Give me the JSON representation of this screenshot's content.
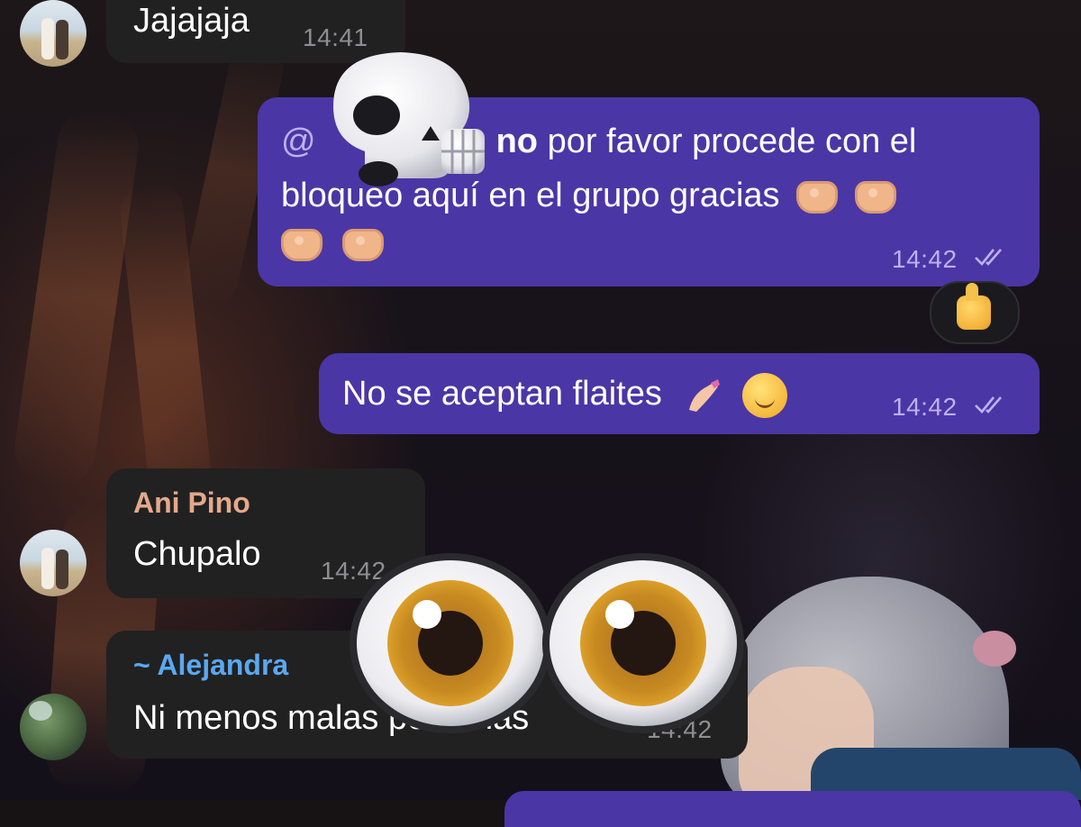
{
  "messages": [
    {
      "id": "m1",
      "direction": "incoming",
      "text": "Jajajaja",
      "time": "14:41"
    },
    {
      "id": "m2",
      "direction": "outgoing",
      "mention_prefix": "@",
      "mention_tail": "no",
      "text_line1": "por favor procede con el",
      "text_line2": "bloqueo aquí en el grupo gracias",
      "emoji": "heart-hands-emoji",
      "time": "14:42",
      "status": "read-double-check",
      "reaction": "thumbs-up-emoji"
    },
    {
      "id": "m3",
      "direction": "outgoing",
      "text": "No se aceptan flaites",
      "emojis": [
        "nail-polish-emoji",
        "relieved-face-emoji"
      ],
      "time": "14:42",
      "status": "read-double-check"
    },
    {
      "id": "m4",
      "direction": "incoming",
      "sender": "Ani Pino",
      "sender_color": "#e3a98a",
      "text": "Chupalo",
      "time": "14:42"
    },
    {
      "id": "m5",
      "direction": "incoming",
      "sender": "~ Alejandra",
      "sender_color": "#5aa8f0",
      "text": "Ni menos malas personas",
      "time": "14:42"
    }
  ],
  "stickers": [
    "skull-emoji",
    "eyes-emoji"
  ],
  "colors": {
    "incoming_bubble": "#212121",
    "outgoing_bubble": "#4b36a6",
    "background": "#171214"
  }
}
